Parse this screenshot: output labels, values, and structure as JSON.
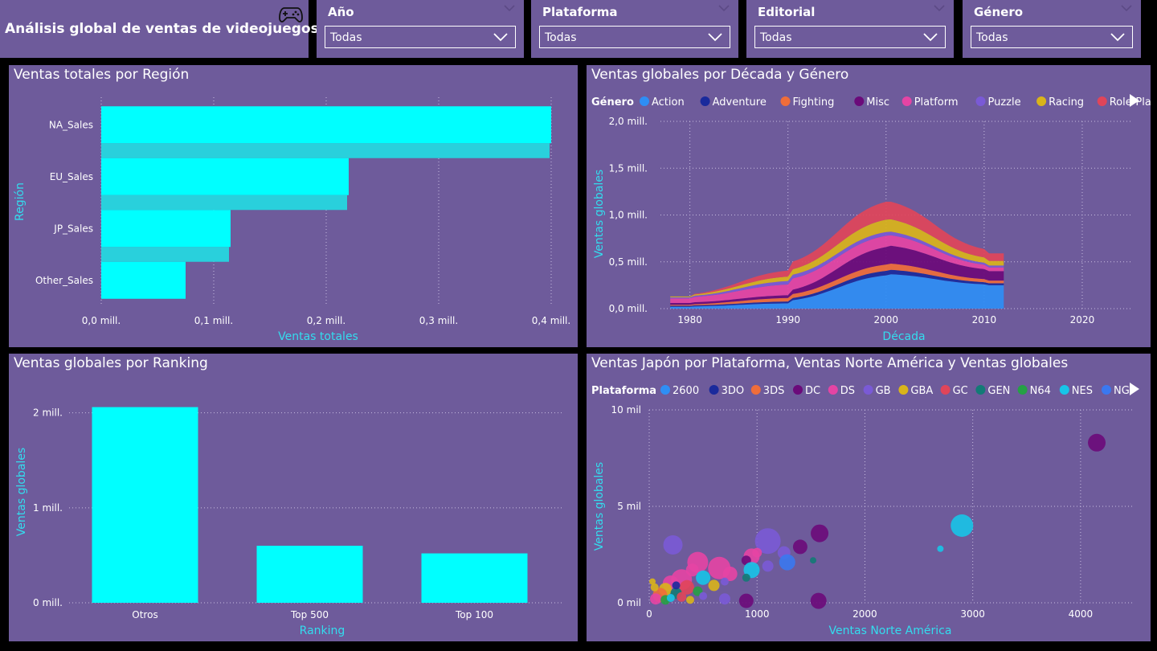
{
  "header": {
    "title": "Análisis global de ventas de videojuegos",
    "icon": "gamepad-icon"
  },
  "slicers": [
    {
      "label": "Año",
      "value": "Todas"
    },
    {
      "label": "Plataforma",
      "value": "Todas"
    },
    {
      "label": "Editorial",
      "value": "Todas"
    },
    {
      "label": "Género",
      "value": "Todas"
    }
  ],
  "colors": {
    "panel": "#6e5b9b",
    "accent": "#00ffff",
    "axis_title": "#33ddee"
  },
  "chart_data": [
    {
      "type": "bar",
      "orientation": "horizontal",
      "title": "Ventas totales por Región",
      "xlabel": "Ventas totales",
      "ylabel": "Región",
      "categories": [
        "NA_Sales",
        "EU_Sales",
        "JP_Sales",
        "Other_Sales"
      ],
      "values": [
        0.4,
        0.22,
        0.115,
        0.075
      ],
      "ticks": [
        "0,0 mill.",
        "0,1 mill.",
        "0,2 mill.",
        "0,3 mill.",
        "0,4 mill."
      ],
      "xlim": [
        0,
        0.4
      ],
      "color": "#00ffff"
    },
    {
      "type": "area",
      "title": "Ventas globales por Década y Género",
      "xlabel": "Década",
      "ylabel": "Ventas globales",
      "legend_title": "Género",
      "legend": [
        {
          "name": "Action",
          "color": "#2e8ef5"
        },
        {
          "name": "Adventure",
          "color": "#1a2a9c"
        },
        {
          "name": "Fighting",
          "color": "#ef6d3a"
        },
        {
          "name": "Misc",
          "color": "#6b0a7a"
        },
        {
          "name": "Platform",
          "color": "#e544a4"
        },
        {
          "name": "Puzzle",
          "color": "#7a5ad6"
        },
        {
          "name": "Racing",
          "color": "#d9b41a"
        },
        {
          "name": "Role-Playing",
          "color": "#e0455a"
        }
      ],
      "x": [
        1980,
        1990,
        2000,
        2010
      ],
      "xticks": [
        "1980",
        "1990",
        "2000",
        "2010",
        "2020"
      ],
      "xlim": [
        1977,
        2025
      ],
      "yticks": [
        "0,0 mill.",
        "0,5 mill.",
        "1,0 mill.",
        "1,5 mill.",
        "2,0 mill."
      ],
      "ylim": [
        0,
        2.0
      ],
      "series": [
        {
          "name": "Action",
          "values": [
            0.02,
            0.06,
            0.38,
            0.25
          ]
        },
        {
          "name": "Adventure",
          "values": [
            0.01,
            0.02,
            0.05,
            0.02
          ]
        },
        {
          "name": "Fighting",
          "values": [
            0.01,
            0.04,
            0.07,
            0.03
          ]
        },
        {
          "name": "Misc",
          "values": [
            0.02,
            0.03,
            0.2,
            0.1
          ]
        },
        {
          "name": "Platform",
          "values": [
            0.05,
            0.12,
            0.12,
            0.04
          ]
        },
        {
          "name": "Puzzle",
          "values": [
            0.01,
            0.04,
            0.04,
            0.02
          ]
        },
        {
          "name": "Racing",
          "values": [
            0.01,
            0.05,
            0.14,
            0.05
          ]
        },
        {
          "name": "Role-Playing",
          "values": [
            0.0,
            0.07,
            0.2,
            0.08
          ]
        }
      ]
    },
    {
      "type": "bar",
      "title": "Ventas globales por Ranking",
      "xlabel": "Ranking",
      "ylabel": "Ventas globales",
      "categories": [
        "Otros",
        "Top 500",
        "Top 100"
      ],
      "values": [
        2.06,
        0.6,
        0.52
      ],
      "yticks": [
        "0 mill.",
        "1 mill.",
        "2 mill."
      ],
      "ylim": [
        0,
        2.2
      ],
      "color": "#00ffff"
    },
    {
      "type": "scatter",
      "title": "Ventas Japón por Plataforma, Ventas Norte América y Ventas globales",
      "xlabel": "Ventas Norte América",
      "ylabel": "Ventas globales",
      "legend_title": "Plataforma",
      "legend": [
        {
          "name": "2600",
          "color": "#2e8ef5"
        },
        {
          "name": "3DO",
          "color": "#1a2a9c"
        },
        {
          "name": "3DS",
          "color": "#ef6d3a"
        },
        {
          "name": "DC",
          "color": "#6b0a7a"
        },
        {
          "name": "DS",
          "color": "#e544a4"
        },
        {
          "name": "GB",
          "color": "#7a5ad6"
        },
        {
          "name": "GBA",
          "color": "#d9b41a"
        },
        {
          "name": "GC",
          "color": "#e0455a"
        },
        {
          "name": "GEN",
          "color": "#137a76"
        },
        {
          "name": "N64",
          "color": "#25a045"
        },
        {
          "name": "NES",
          "color": "#17c4e8"
        },
        {
          "name": "NG",
          "color": "#3a78f0"
        }
      ],
      "xticks": [
        "0",
        "1000",
        "2000",
        "3000",
        "4000"
      ],
      "xlim": [
        0,
        4500
      ],
      "yticks": [
        "0 mil",
        "5 mil",
        "10 mil"
      ],
      "ylim": [
        0,
        10000
      ],
      "points": [
        {
          "x": 4150,
          "y": 8300,
          "r": 11,
          "platform": "DC"
        },
        {
          "x": 2900,
          "y": 4000,
          "r": 14,
          "platform": "NES"
        },
        {
          "x": 2700,
          "y": 2800,
          "r": 4,
          "platform": "NES"
        },
        {
          "x": 1580,
          "y": 3600,
          "r": 11,
          "platform": "DC"
        },
        {
          "x": 1100,
          "y": 3200,
          "r": 16,
          "platform": "GB"
        },
        {
          "x": 1400,
          "y": 2900,
          "r": 9,
          "platform": "DC"
        },
        {
          "x": 1250,
          "y": 2600,
          "r": 8,
          "platform": "GB"
        },
        {
          "x": 1520,
          "y": 2200,
          "r": 4,
          "platform": "GEN"
        },
        {
          "x": 1280,
          "y": 2100,
          "r": 10,
          "platform": "NG"
        },
        {
          "x": 1000,
          "y": 2600,
          "r": 6,
          "platform": "DS"
        },
        {
          "x": 950,
          "y": 2400,
          "r": 10,
          "platform": "DS"
        },
        {
          "x": 900,
          "y": 2200,
          "r": 6,
          "platform": "DC"
        },
        {
          "x": 950,
          "y": 1700,
          "r": 10,
          "platform": "NES"
        },
        {
          "x": 1100,
          "y": 1900,
          "r": 7,
          "platform": "GB"
        },
        {
          "x": 900,
          "y": 1300,
          "r": 5,
          "platform": "GEN"
        },
        {
          "x": 220,
          "y": 3000,
          "r": 12,
          "platform": "GB"
        },
        {
          "x": 450,
          "y": 2100,
          "r": 13,
          "platform": "DS"
        },
        {
          "x": 650,
          "y": 1800,
          "r": 14,
          "platform": "DS"
        },
        {
          "x": 400,
          "y": 1700,
          "r": 8,
          "platform": "DS"
        },
        {
          "x": 750,
          "y": 1500,
          "r": 9,
          "platform": "DS"
        },
        {
          "x": 300,
          "y": 1200,
          "r": 13,
          "platform": "DS"
        },
        {
          "x": 500,
          "y": 1300,
          "r": 9,
          "platform": "NES"
        },
        {
          "x": 200,
          "y": 1000,
          "r": 10,
          "platform": "DS"
        },
        {
          "x": 700,
          "y": 1100,
          "r": 5,
          "platform": "GB"
        },
        {
          "x": 600,
          "y": 900,
          "r": 7,
          "platform": "GBA"
        },
        {
          "x": 350,
          "y": 800,
          "r": 9,
          "platform": "GC"
        },
        {
          "x": 150,
          "y": 700,
          "r": 8,
          "platform": "GBA"
        },
        {
          "x": 250,
          "y": 500,
          "r": 7,
          "platform": "GEN"
        },
        {
          "x": 450,
          "y": 600,
          "r": 6,
          "platform": "N64"
        },
        {
          "x": 100,
          "y": 400,
          "r": 9,
          "platform": "3DS"
        },
        {
          "x": 300,
          "y": 300,
          "r": 6,
          "platform": "GC"
        },
        {
          "x": 500,
          "y": 350,
          "r": 5,
          "platform": "GB"
        },
        {
          "x": 60,
          "y": 200,
          "r": 7,
          "platform": "Platform"
        },
        {
          "x": 150,
          "y": 150,
          "r": 6,
          "platform": "N64"
        },
        {
          "x": 380,
          "y": 150,
          "r": 5,
          "platform": "GBA"
        },
        {
          "x": 700,
          "y": 200,
          "r": 7,
          "platform": "GB"
        },
        {
          "x": 900,
          "y": 100,
          "r": 9,
          "platform": "DC"
        },
        {
          "x": 1570,
          "y": 100,
          "r": 10,
          "platform": "DC"
        },
        {
          "x": 50,
          "y": 800,
          "r": 5,
          "platform": "GBA"
        },
        {
          "x": 30,
          "y": 1100,
          "r": 4,
          "platform": "GBA"
        },
        {
          "x": 200,
          "y": 250,
          "r": 5,
          "platform": "NES"
        },
        {
          "x": 250,
          "y": 900,
          "r": 5,
          "platform": "3DO"
        }
      ]
    }
  ]
}
